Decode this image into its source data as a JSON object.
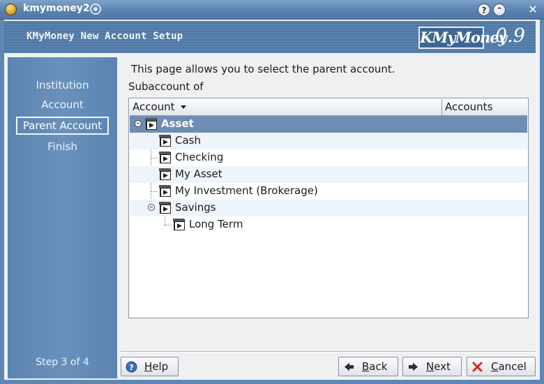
{
  "window": {
    "title": "kmymoney2"
  },
  "header": {
    "title": "KMyMoney New Account Setup",
    "logo": "KMyMoney",
    "version": "0.9"
  },
  "sidebar": {
    "steps": [
      "Institution",
      "Account",
      "Parent Account",
      "Finish"
    ],
    "active_step": "Parent Account",
    "step_count": "Step 3 of 4"
  },
  "content": {
    "intro": "This page allows you to select the parent account.",
    "subaccount_label": "Subaccount of",
    "columns": [
      "Account",
      "Accounts"
    ],
    "tree": [
      {
        "label": "Asset",
        "level": 0,
        "expanded": true,
        "selected": true
      },
      {
        "label": "Cash",
        "level": 1
      },
      {
        "label": "Checking",
        "level": 1
      },
      {
        "label": "My Asset",
        "level": 1
      },
      {
        "label": "My Investment (Brokerage)",
        "level": 1
      },
      {
        "label": "Savings",
        "level": 1,
        "expanded": true
      },
      {
        "label": "Long Term",
        "level": 2
      }
    ]
  },
  "buttons": {
    "help": {
      "label": "Help",
      "mnemonic": "H",
      "rest": "elp"
    },
    "back": {
      "label": "Back",
      "mnemonic": "B",
      "rest": "ack"
    },
    "next": {
      "label": "Next",
      "mnemonic": "N",
      "rest": "ext"
    },
    "cancel": {
      "label": "Cancel",
      "mnemonic": "C",
      "rest": "ancel"
    }
  },
  "colors": {
    "accent": "#5e87b3",
    "selection": "#6d8db3"
  },
  "icons": {
    "app": "kmymoney-app-icon",
    "pin": "pin-icon",
    "account": "account-folder-icon",
    "help": "help-question-icon",
    "back": "arrow-left-icon",
    "next": "arrow-right-icon",
    "cancel": "red-x-icon"
  }
}
